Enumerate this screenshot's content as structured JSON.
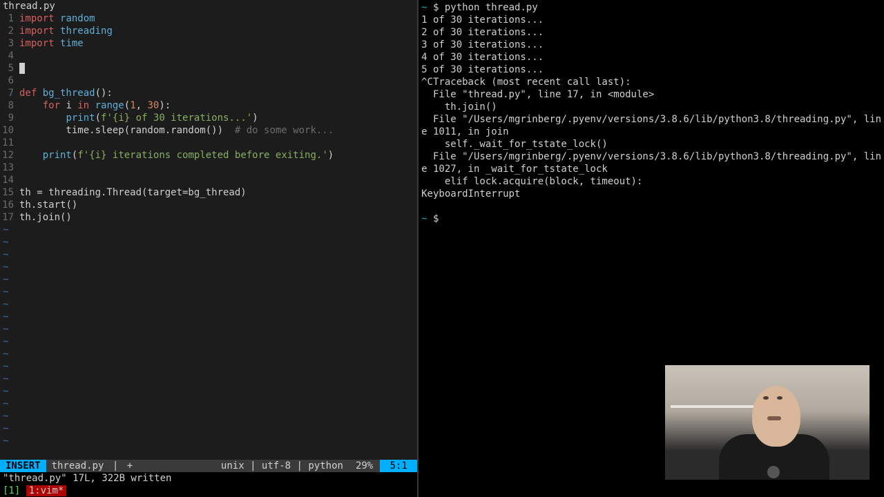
{
  "editor": {
    "filename": "thread.py",
    "lines": [
      {
        "n": 1,
        "tokens": [
          [
            "kw",
            "import "
          ],
          [
            "mod",
            "random"
          ]
        ]
      },
      {
        "n": 2,
        "tokens": [
          [
            "kw",
            "import "
          ],
          [
            "mod",
            "threading"
          ]
        ]
      },
      {
        "n": 3,
        "tokens": [
          [
            "kw",
            "import "
          ],
          [
            "mod",
            "time"
          ]
        ]
      },
      {
        "n": 4,
        "tokens": []
      },
      {
        "n": 5,
        "tokens": [
          [
            "cursor",
            ""
          ]
        ]
      },
      {
        "n": 6,
        "tokens": []
      },
      {
        "n": 7,
        "tokens": [
          [
            "kw",
            "def "
          ],
          [
            "fn",
            "bg_thread"
          ],
          [
            "plain",
            "():"
          ]
        ]
      },
      {
        "n": 8,
        "tokens": [
          [
            "plain",
            "    "
          ],
          [
            "kw",
            "for "
          ],
          [
            "plain",
            "i "
          ],
          [
            "kw",
            "in "
          ],
          [
            "builtin",
            "range"
          ],
          [
            "plain",
            "("
          ],
          [
            "num",
            "1"
          ],
          [
            "plain",
            ", "
          ],
          [
            "num",
            "30"
          ],
          [
            "plain",
            "):"
          ]
        ]
      },
      {
        "n": 9,
        "tokens": [
          [
            "plain",
            "        "
          ],
          [
            "builtin",
            "print"
          ],
          [
            "plain",
            "("
          ],
          [
            "str",
            "f'{i} of 30 iterations...'"
          ],
          [
            "plain",
            ")"
          ]
        ]
      },
      {
        "n": 10,
        "tokens": [
          [
            "plain",
            "        time.sleep(random.random())  "
          ],
          [
            "cmt",
            "# do some work..."
          ]
        ]
      },
      {
        "n": 11,
        "tokens": []
      },
      {
        "n": 12,
        "tokens": [
          [
            "plain",
            "    "
          ],
          [
            "builtin",
            "print"
          ],
          [
            "plain",
            "("
          ],
          [
            "str",
            "f'{i} iterations completed before exiting.'"
          ],
          [
            "plain",
            ")"
          ]
        ]
      },
      {
        "n": 13,
        "tokens": []
      },
      {
        "n": 14,
        "tokens": []
      },
      {
        "n": 15,
        "tokens": [
          [
            "plain",
            "th = threading.Thread(target=bg_thread)"
          ]
        ]
      },
      {
        "n": 16,
        "tokens": [
          [
            "plain",
            "th.start()"
          ]
        ]
      },
      {
        "n": 17,
        "tokens": [
          [
            "plain",
            "th.join()"
          ]
        ]
      }
    ],
    "tilde": "~"
  },
  "status": {
    "mode": "INSERT",
    "file": "thread.py",
    "modified": "+",
    "sep": "|",
    "filetype": "unix | utf-8 | python",
    "percent": "29%",
    "position": "5:1"
  },
  "message": "\"thread.py\" 17L, 322B written",
  "tmux": {
    "session": "[1]",
    "window": "1:vim*"
  },
  "terminal": {
    "prompt_tilde": "~",
    "prompt_dollar": "$",
    "cmd": "python thread.py",
    "lines": [
      "1 of 30 iterations...",
      "2 of 30 iterations...",
      "3 of 30 iterations...",
      "4 of 30 iterations...",
      "5 of 30 iterations...",
      "^CTraceback (most recent call last):",
      "  File \"thread.py\", line 17, in <module>",
      "    th.join()",
      "  File \"/Users/mgrinberg/.pyenv/versions/3.8.6/lib/python3.8/threading.py\", lin",
      "e 1011, in join",
      "    self._wait_for_tstate_lock()",
      "  File \"/Users/mgrinberg/.pyenv/versions/3.8.6/lib/python3.8/threading.py\", lin",
      "e 1027, in _wait_for_tstate_lock",
      "    elif lock.acquire(block, timeout):",
      "KeyboardInterrupt"
    ],
    "blank_prompt": true
  }
}
